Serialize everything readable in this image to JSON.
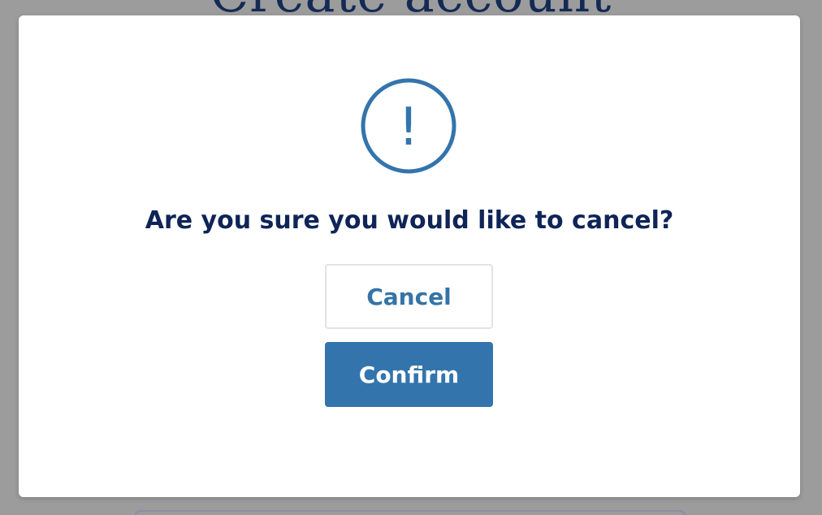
{
  "background": {
    "title": "Create account"
  },
  "dialog": {
    "icon": "exclamation-circle-icon",
    "icon_glyph": "!",
    "message": "Are you sure you would like to cancel?",
    "cancel_label": "Cancel",
    "confirm_label": "Confirm"
  },
  "colors": {
    "accent": "#3474ac",
    "text_dark": "#0f2457",
    "overlay": "#9c9c9c"
  }
}
